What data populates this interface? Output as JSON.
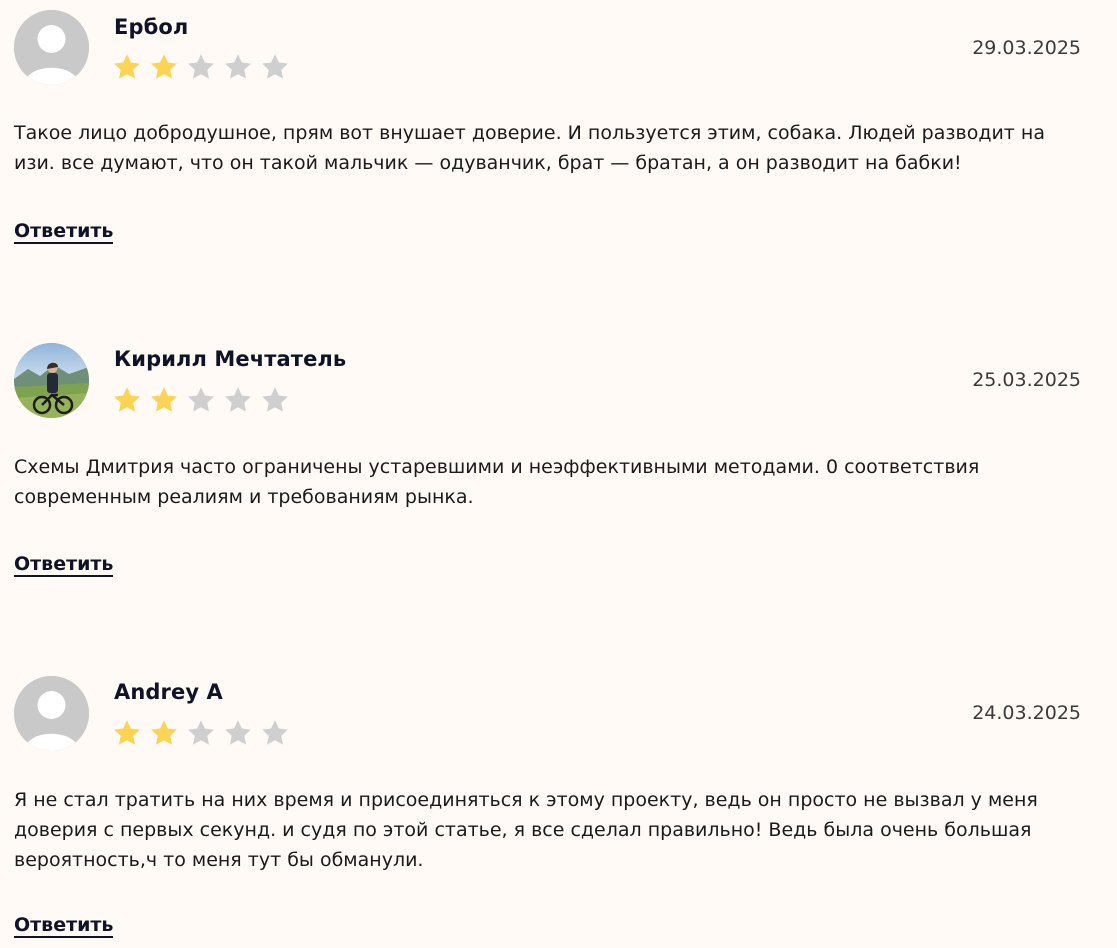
{
  "colors": {
    "background": "#fffaf6",
    "star_filled": "#fbd355",
    "star_empty": "#cfcfcf",
    "author": "#0e1326"
  },
  "comments": [
    {
      "author": "Ербол",
      "date": "29.03.2025",
      "rating": 2,
      "max_rating": 5,
      "avatar": "default-user-icon",
      "text": "Такое лицо добродушное, прям вот внушает доверие. И пользуется этим, собака. Людей разводит на изи. все думают, что он такой мальчик — одуванчик, брат — братан, а он разводит на бабки!",
      "reply_label": "Ответить"
    },
    {
      "author": "Кирилл Мечтатель",
      "date": "25.03.2025",
      "rating": 2,
      "max_rating": 5,
      "avatar": "user-photo",
      "text": "Схемы Дмитрия часто ограничены устаревшими и неэффективными методами. 0 соответствия современным реалиям и требованиям рынка.",
      "reply_label": "Ответить"
    },
    {
      "author": "Andrey A",
      "date": "24.03.2025",
      "rating": 2,
      "max_rating": 5,
      "avatar": "default-user-icon",
      "text": "Я не стал тратить на них время и присоединяться к этому проекту, ведь он просто не вызвал у меня доверия с первых секунд. и судя по этой статье, я все сделал правильно! Ведь была очень большая вероятность,ч то меня тут бы обманули.",
      "reply_label": "Ответить"
    }
  ]
}
